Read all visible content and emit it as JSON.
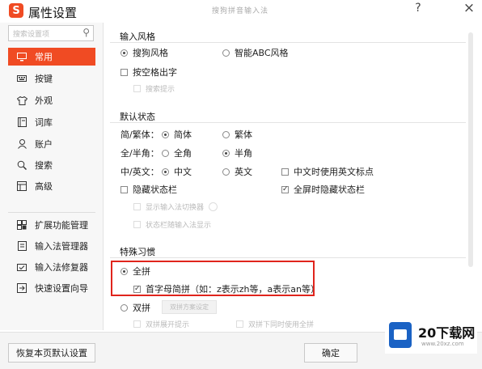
{
  "window": {
    "title": "属性设置",
    "subtitle": "搜狗拼音输入法",
    "help_label": "?",
    "close_label": "×"
  },
  "sidebar": {
    "search_placeholder": "搜索设置项",
    "items": [
      {
        "label": "常用",
        "icon": "monitor-icon",
        "active": true
      },
      {
        "label": "按键",
        "icon": "keyboard-icon"
      },
      {
        "label": "外观",
        "icon": "shirt-icon"
      },
      {
        "label": "词库",
        "icon": "book-icon"
      },
      {
        "label": "账户",
        "icon": "user-icon"
      },
      {
        "label": "搜索",
        "icon": "search-icon"
      },
      {
        "label": "高级",
        "icon": "layers-icon"
      }
    ],
    "tools": [
      {
        "label": "扩展功能管理",
        "icon": "extension-icon"
      },
      {
        "label": "输入法管理器",
        "icon": "manager-icon"
      },
      {
        "label": "输入法修复器",
        "icon": "repair-icon"
      },
      {
        "label": "快速设置向导",
        "icon": "wizard-icon"
      }
    ]
  },
  "input_style": {
    "heading": "输入风格",
    "sogou_style": "搜狗风格",
    "abc_style": "智能ABC风格",
    "space_output": "按空格出字",
    "faint_option": "搜索提示"
  },
  "default_state": {
    "heading": "默认状态",
    "simp_trad_label": "简/繁体：",
    "simplified": "简体",
    "traditional": "繁体",
    "width_label": "全/半角：",
    "full_width": "全角",
    "half_width": "半角",
    "lang_label": "中/英文：",
    "chinese": "中文",
    "english": "英文",
    "cn_use_en_punct": "中文时使用英文标点",
    "hide_status_bar": "隐藏状态栏",
    "fullscreen_hide_status": "全屏时隐藏状态栏",
    "faint_sub_1": "显示输入法切换器",
    "faint_sub_2": "状态栏随输入法显示"
  },
  "special_habits": {
    "heading": "特殊习惯",
    "full_pinyin": "全拼",
    "initial_abbrev": "首字母简拼（如：z表示zh等，a表示an等）",
    "shuangpin": "双拼",
    "faint_btn": "双拼方案设定",
    "faint_opt_1": "双拼展开提示",
    "faint_opt_2": "双拼下同时使用全拼"
  },
  "footer": {
    "restore_label": "恢复本页默认设置",
    "ok_label": "确定"
  },
  "watermark": {
    "brand": "20下载网",
    "url": "www.20xz.com"
  },
  "colors": {
    "accent": "#f04b23",
    "highlight_border": "#e0241c"
  }
}
